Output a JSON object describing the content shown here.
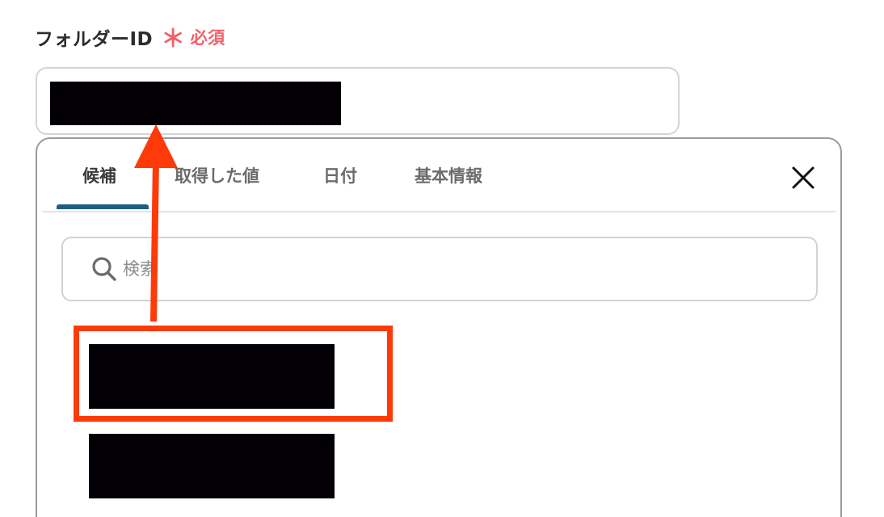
{
  "field": {
    "label": "フォルダーID",
    "required_mark": "＊",
    "required_text": "必須",
    "value": ""
  },
  "popup": {
    "tabs": [
      {
        "label": "候補",
        "active": true
      },
      {
        "label": "取得した値",
        "active": false
      },
      {
        "label": "日付",
        "active": false
      },
      {
        "label": "基本情報",
        "active": false
      }
    ],
    "close_icon": "close-icon",
    "search": {
      "placeholder": "検索",
      "icon": "search-icon"
    },
    "options": [
      {
        "label": "",
        "redacted": true,
        "highlighted": true
      },
      {
        "label": "",
        "redacted": true,
        "highlighted": false
      }
    ]
  },
  "colors": {
    "required": "#f0616a",
    "active_tab_underline": "#1d5f82",
    "annotation": "#fd3a08",
    "redaction": "#020004"
  }
}
